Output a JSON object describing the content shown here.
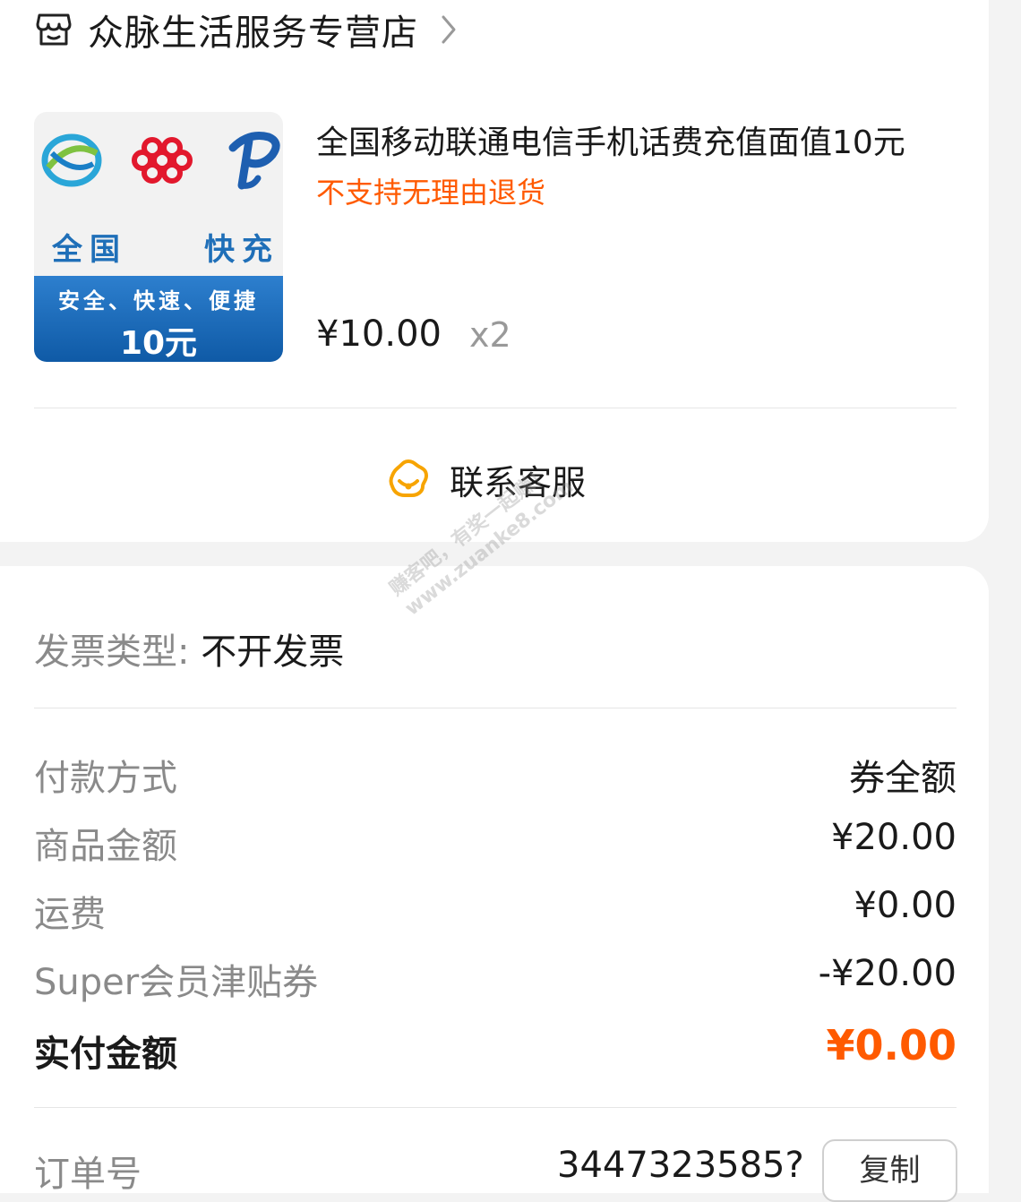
{
  "store": {
    "name": "众脉生活服务专营店"
  },
  "product": {
    "thumbnail": {
      "label_left": "全国",
      "label_right": "快充",
      "band_line1": "安全、快速、便捷",
      "band_line2": "10元"
    },
    "title": "全国移动联通电信手机话费充值面值10元",
    "notice": "不支持无理由退货",
    "price": "¥10.00",
    "quantity": "x2"
  },
  "customer_service": {
    "label": "联系客服"
  },
  "watermark": {
    "line1": "赚客吧，有奖一起赚！",
    "line2": "www.zuanke8.com"
  },
  "invoice": {
    "label": "发票类型:",
    "value": "不开发票"
  },
  "summary": {
    "rows": [
      {
        "label": "付款方式",
        "value": "券全额"
      },
      {
        "label": "商品金额",
        "value": "¥20.00"
      },
      {
        "label": "运费",
        "value": "¥0.00"
      },
      {
        "label": "Super会员津贴券",
        "value": "-¥20.00"
      }
    ],
    "total": {
      "label": "实付金额",
      "value": "¥0.00"
    }
  },
  "order": {
    "label": "订单号",
    "number": "3447323585?",
    "copy_label": "复制"
  },
  "colors": {
    "accent": "#ff5a00",
    "cs_icon": "#f7a400",
    "thumb_blue": "#1f6fb8"
  }
}
